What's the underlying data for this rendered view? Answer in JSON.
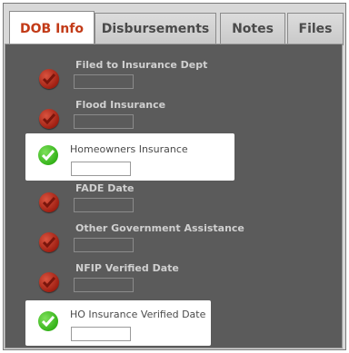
{
  "tabs": [
    {
      "label": "DOB Info",
      "active": true
    },
    {
      "label": "Disbursements",
      "active": false
    },
    {
      "label": "Notes",
      "active": false
    },
    {
      "label": "Files",
      "active": false
    }
  ],
  "fields": [
    {
      "label": "Filed to Insurance Dept",
      "status": "incomplete",
      "value": ""
    },
    {
      "label": "Flood Insurance",
      "status": "incomplete",
      "value": ""
    },
    {
      "label": "Homeowners Insurance",
      "status": "complete",
      "value": ""
    },
    {
      "label": "FADE Date",
      "status": "incomplete",
      "value": ""
    },
    {
      "label": "Other Government Assistance",
      "status": "incomplete",
      "value": ""
    },
    {
      "label": "NFIP Verified Date",
      "status": "incomplete",
      "value": ""
    },
    {
      "label": "HO Insurance Verified Date",
      "status": "complete",
      "value": ""
    }
  ],
  "colors": {
    "active_tab_text": "#c23a17",
    "incomplete_icon": "#9f1f12",
    "complete_icon": "#35b31a",
    "panel_background": "#5b5b5b"
  }
}
